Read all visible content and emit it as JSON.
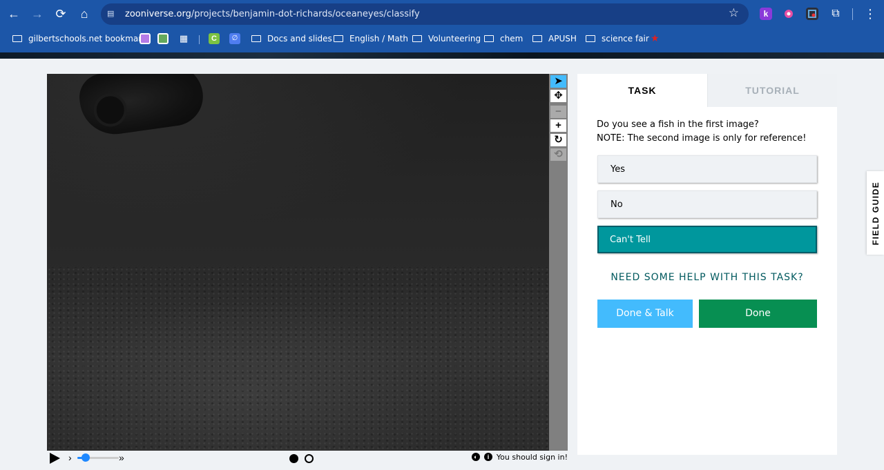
{
  "browser": {
    "url_domain": "zooniverse.org",
    "url_path": "/projects/benjamin-dot-richards/oceaneyes/classify",
    "extensions": [
      {
        "icon": "k-extension-icon",
        "label": "k",
        "color": "#8a3ad9"
      },
      {
        "icon": "pink-extension-icon",
        "label": "",
        "color": "#e74fa3"
      },
      {
        "icon": "screen-extension-icon",
        "label": "",
        "color": "#2b2f3a"
      }
    ]
  },
  "bookmarks": {
    "items": [
      {
        "label": "gilbertschools.net bookmarks",
        "type": "managed-folder"
      },
      {
        "label": "Docs and slides",
        "type": "folder"
      },
      {
        "label": "English / Math",
        "type": "folder"
      },
      {
        "label": "Volunteering",
        "type": "folder"
      },
      {
        "label": "chem",
        "type": "folder"
      },
      {
        "label": "APUSH",
        "type": "folder"
      },
      {
        "label": "science fair",
        "type": "folder"
      }
    ]
  },
  "viewer": {
    "tools": [
      "pointer",
      "move",
      "zoom-out",
      "zoom-in",
      "rotate",
      "reset"
    ],
    "playback_speed_fraction": 0.2,
    "sign_in_text": "You should sign in!",
    "frames": 2,
    "current_frame": 1
  },
  "task": {
    "tabs": {
      "task": "TASK",
      "tutorial": "TUTORIAL"
    },
    "question_line1": "Do you see a fish in the first image?",
    "question_line2": "NOTE: The second image is only for reference!",
    "answers": [
      "Yes",
      "No",
      "Can't Tell"
    ],
    "selected_answer": "Can't Tell",
    "help_link": "NEED SOME HELP WITH THIS TASK?",
    "done_talk": "Done & Talk",
    "done": "Done"
  },
  "field_guide": "FIELD GUIDE",
  "colors": {
    "browser_blue": "#1c56a8",
    "selected_answer": "#00979d",
    "done_green": "#078f52",
    "done_talk_blue": "#43bbfd"
  }
}
